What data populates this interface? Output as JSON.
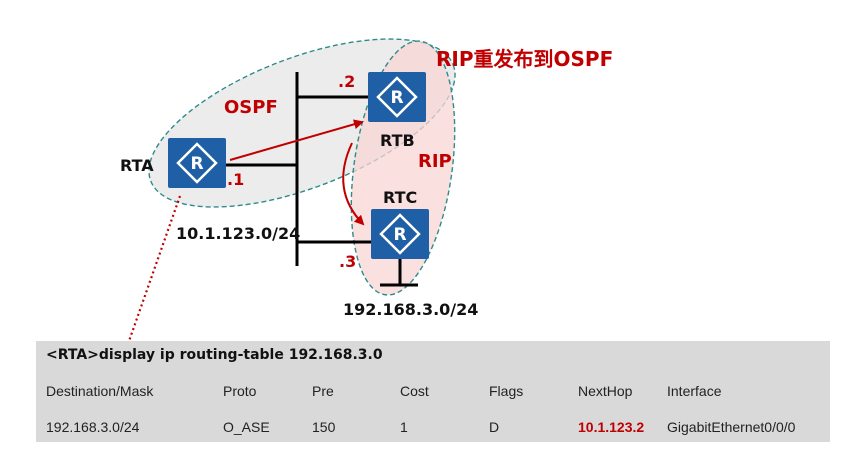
{
  "diagram": {
    "title": "RIP重发布到OSPF",
    "area_ospf": "OSPF",
    "area_rip": "RIP",
    "routers": {
      "rta": "RTA",
      "rtb": "RTB",
      "rtc": "RTC"
    },
    "interfaces": {
      "rta": ".1",
      "rtb": ".2",
      "rtc": ".3"
    },
    "networks": {
      "segment": "10.1.123.0/24",
      "lan": "192.168.3.0/24"
    },
    "colors": {
      "router_fill": "#1f5fa5",
      "ospf_area": "#e6e6e6",
      "rip_area": "#f9dcdc",
      "area_border": "#2e8b8b",
      "accent_red": "#c00000"
    }
  },
  "terminal": {
    "command": "<RTA>display ip routing-table 192.168.3.0",
    "headers": [
      "Destination/Mask",
      "Proto",
      "Pre",
      "Cost",
      "Flags",
      "NextHop",
      "Interface"
    ],
    "row": [
      "192.168.3.0/24",
      "O_ASE",
      "150",
      "1",
      "D",
      "10.1.123.2",
      "GigabitEthernet0/0/0"
    ]
  }
}
